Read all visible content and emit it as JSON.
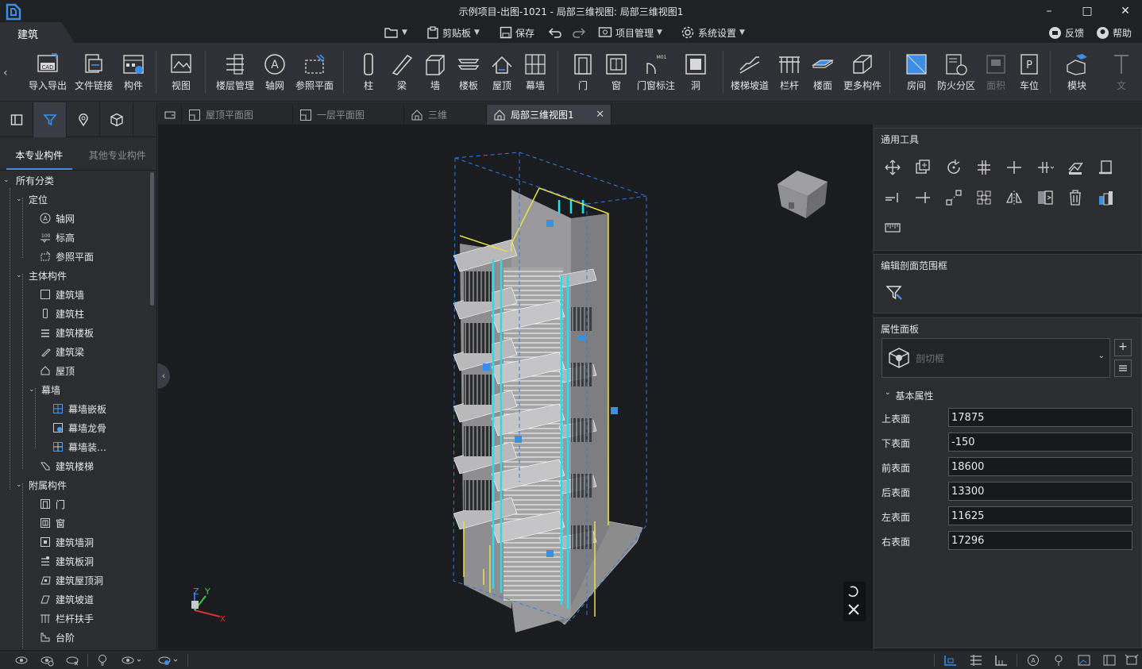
{
  "window": {
    "title": "示例项目-出图-1021 - 局部三维视图: 局部三维视图1",
    "minimize": "–",
    "maximize": "□",
    "close": "✕"
  },
  "menu": {
    "active_tab": "建筑",
    "clipboard": "剪贴板",
    "save": "保存",
    "project_mgmt": "项目管理",
    "system_settings": "系统设置",
    "feedback": "反馈",
    "help": "帮助"
  },
  "ribbon": {
    "items": [
      {
        "label": "导入导出",
        "icon": "cad-import-icon"
      },
      {
        "label": "文件链接",
        "icon": "file-link-icon"
      },
      {
        "label": "构件",
        "icon": "component-icon"
      },
      {
        "label": "视图",
        "icon": "view-icon"
      },
      {
        "label": "楼层管理",
        "icon": "floor-management-icon"
      },
      {
        "label": "轴网",
        "icon": "axis-grid-icon"
      },
      {
        "label": "参照平面",
        "icon": "reference-plane-icon"
      },
      {
        "label": "柱",
        "icon": "column-icon"
      },
      {
        "label": "梁",
        "icon": "beam-icon"
      },
      {
        "label": "墙",
        "icon": "wall-icon"
      },
      {
        "label": "楼板",
        "icon": "slab-icon"
      },
      {
        "label": "屋顶",
        "icon": "roof-icon"
      },
      {
        "label": "幕墙",
        "icon": "curtain-wall-icon"
      },
      {
        "label": "门",
        "icon": "door-icon"
      },
      {
        "label": "窗",
        "icon": "window-icon"
      },
      {
        "label": "门窗标注",
        "icon": "door-window-tag-icon"
      },
      {
        "label": "洞",
        "icon": "opening-icon"
      },
      {
        "label": "楼梯坡道",
        "icon": "stair-ramp-icon"
      },
      {
        "label": "栏杆",
        "icon": "railing-icon"
      },
      {
        "label": "楼面",
        "icon": "floor-surface-icon"
      },
      {
        "label": "更多构件",
        "icon": "more-components-icon"
      },
      {
        "label": "房间",
        "icon": "room-icon"
      },
      {
        "label": "防火分区",
        "icon": "fire-zone-icon"
      },
      {
        "label": "面积",
        "icon": "area-icon"
      },
      {
        "label": "车位",
        "icon": "parking-icon"
      },
      {
        "label": "模块",
        "icon": "module-icon"
      },
      {
        "label": "文",
        "icon": "text-icon"
      }
    ]
  },
  "left_panel": {
    "tabs": [
      "本专业构件",
      "其他专业构件"
    ],
    "tree": {
      "root": "所有分类",
      "positioning": "定位",
      "axis": "轴网",
      "elevation": "标高",
      "ref_plane": "参照平面",
      "main": "主体构件",
      "arch_wall": "建筑墙",
      "arch_column": "建筑柱",
      "arch_slab": "建筑楼板",
      "arch_beam": "建筑梁",
      "roof": "屋顶",
      "curtain": "幕墙",
      "curtain_panel": "幕墙嵌板",
      "curtain_mullion": "幕墙龙骨",
      "curtain_deco": "幕墙装…",
      "arch_stair": "建筑楼梯",
      "attached": "附属构件",
      "door": "门",
      "window": "窗",
      "wall_opening": "建筑墙洞",
      "slab_opening": "建筑板洞",
      "roof_opening": "建筑屋顶洞",
      "ramp": "建筑坡道",
      "railing": "栏杆扶手",
      "steps": "台阶"
    }
  },
  "doc_tabs": [
    "屋顶平面图",
    "一层平面图",
    "三维",
    "局部三维视图1"
  ],
  "right_panel": {
    "general_tools": "通用工具",
    "edit_section_box": "编辑剖面范围框",
    "property_panel": "属性面板",
    "type_select": "剖切框",
    "basic_props": "基本属性",
    "props": [
      {
        "label": "上表面",
        "value": "17875"
      },
      {
        "label": "下表面",
        "value": "-150"
      },
      {
        "label": "前表面",
        "value": "18600"
      },
      {
        "label": "后表面",
        "value": "13300"
      },
      {
        "label": "左表面",
        "value": "11625"
      },
      {
        "label": "右表面",
        "value": "17296"
      }
    ]
  },
  "viewport": {
    "axis_z": "Z",
    "axis_y": "Y",
    "axis_x": "X"
  },
  "colors": {
    "accent": "#3d8fe6",
    "section_box": "#2f7de6",
    "highlight_yellow": "#e8e04a",
    "highlight_cyan": "#22e0f0"
  }
}
